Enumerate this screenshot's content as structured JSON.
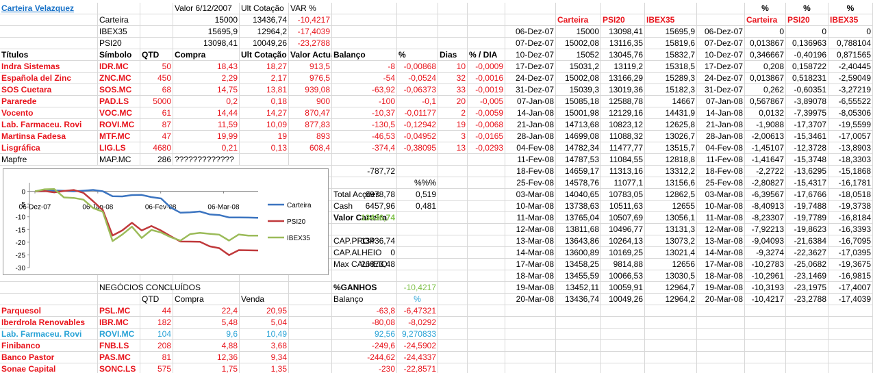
{
  "header": {
    "title": "Carteira Velazquez",
    "col_headers": [
      "Valor 6/12/2007",
      "Ult Cotação",
      "VAR %"
    ],
    "index_rows": [
      {
        "name": "Carteira",
        "base": "15000",
        "current": "13436,74",
        "var": "-10,4217"
      },
      {
        "name": "IBEX35",
        "base": "15695,9",
        "current": "12964,2",
        "var": "-17,4039"
      },
      {
        "name": "PSI20",
        "base": "13098,41",
        "current": "10049,26",
        "var": "-23,2788"
      }
    ]
  },
  "holdings": {
    "headers": [
      "Títulos",
      "Símbolo",
      "QTD",
      "Compra",
      "Ult Cotação",
      "Valor Actual",
      "Balanço",
      "%",
      "Dias",
      "% / DIA"
    ],
    "rows": [
      [
        "Indra Sistemas",
        "IDR.MC",
        "50",
        "18,43",
        "18,27",
        "913,5",
        "-8",
        "-0,00868",
        "10",
        "-0,0009"
      ],
      [
        "Española del Zinc",
        "ZNC.MC",
        "450",
        "2,29",
        "2,17",
        "976,5",
        "-54",
        "-0,0524",
        "32",
        "-0,0016"
      ],
      [
        "SOS Cuetara",
        "SOS.MC",
        "68",
        "14,75",
        "13,81",
        "939,08",
        "-63,92",
        "-0,06373",
        "33",
        "-0,0019"
      ],
      [
        "Pararede",
        "PAD.LS",
        "5000",
        "0,2",
        "0,18",
        "900",
        "-100",
        "-0,1",
        "20",
        "-0,005"
      ],
      [
        "Vocento",
        "VOC.MC",
        "61",
        "14,44",
        "14,27",
        "870,47",
        "-10,37",
        "-0,01177",
        "2",
        "-0,0059"
      ],
      [
        "Lab. Farmaceu. Rovi",
        "ROVI.MC",
        "87",
        "11,59",
        "10,09",
        "877,83",
        "-130,5",
        "-0,12942",
        "19",
        "-0,0068"
      ],
      [
        "Martinsa Fadesa",
        "MTF.MC",
        "47",
        "19,99",
        "19",
        "893",
        "-46,53",
        "-0,04952",
        "3",
        "-0,0165"
      ],
      [
        "Lisgráfica",
        "LIG.LS",
        "4680",
        "0,21",
        "0,13",
        "608,4",
        "-374,4",
        "-0,38095",
        "13",
        "-0,0293"
      ]
    ],
    "mapfre": {
      "name": "Mapfre",
      "symbol": "MAP.MC",
      "qtd": "286",
      "compra": "?????????????"
    },
    "balance_total": "-787,72"
  },
  "summary": {
    "pct_header": "%%%",
    "rows": [
      {
        "label": "Total Acções",
        "value": "6978,78",
        "pct": "0,519"
      },
      {
        "label": "Cash",
        "value": "6457,96",
        "pct": "0,481"
      }
    ],
    "valor_label": "Valor Carteira",
    "valor_value": "13436,74",
    "cap_rows": [
      {
        "label": "CAP.PROP",
        "value": "13436,74"
      },
      {
        "label": "CAP.ALHEIO",
        "value": "0"
      },
      {
        "label": "Max CALHEIO",
        "value": "26873,48"
      }
    ],
    "ganhos_label": "%GANHOS",
    "ganhos_value": "-10,4217"
  },
  "closed": {
    "title": "NEGÓCIOS CONCLUÍDOS",
    "headers": [
      "QTD",
      "Compra",
      "Venda",
      "Balanço",
      "%"
    ],
    "rows": [
      [
        "Parquesol",
        "PSL.MC",
        "44",
        "22,4",
        "20,95",
        "-63,8",
        "-6,47321"
      ],
      [
        "Iberdrola Renovables",
        "IBR.MC",
        "182",
        "5,48",
        "5,04",
        "-80,08",
        "-8,0292"
      ],
      [
        "Lab. Farmaceu. Rovi",
        "ROVI.MC",
        "104",
        "9,6",
        "10,49",
        "92,56",
        "9,270833"
      ],
      [
        "Finibanco",
        "FNB.LS",
        "208",
        "4,88",
        "3,68",
        "-249,6",
        "-24,5902"
      ],
      [
        "Banco Pastor",
        "PAS.MC",
        "81",
        "12,36",
        "9,34",
        "-244,62",
        "-24,4337"
      ],
      [
        "Sonae Capital",
        "SONC.LS",
        "575",
        "1,75",
        "1,35",
        "-230",
        "-22,8571"
      ]
    ]
  },
  "history": {
    "headers": [
      "Carteira",
      "PSI20",
      "IBEX35"
    ],
    "rows": [
      [
        "06-Dez-07",
        "15000",
        "13098,41",
        "15695,9"
      ],
      [
        "07-Dez-07",
        "15002,08",
        "13116,35",
        "15819,6"
      ],
      [
        "10-Dez-07",
        "15052",
        "13045,76",
        "15832,7"
      ],
      [
        "17-Dez-07",
        "15031,2",
        "13119,2",
        "15318,5"
      ],
      [
        "24-Dez-07",
        "15002,08",
        "13166,29",
        "15289,3"
      ],
      [
        "31-Dez-07",
        "15039,3",
        "13019,36",
        "15182,3"
      ],
      [
        "07-Jan-08",
        "15085,18",
        "12588,78",
        "14667"
      ],
      [
        "14-Jan-08",
        "15001,98",
        "12129,16",
        "14431,9"
      ],
      [
        "21-Jan-08",
        "14713,68",
        "10823,12",
        "12625,8"
      ],
      [
        "28-Jan-08",
        "14699,08",
        "11088,32",
        "13026,7"
      ],
      [
        "04-Fev-08",
        "14782,34",
        "11477,77",
        "13515,7"
      ],
      [
        "11-Fev-08",
        "14787,53",
        "11084,55",
        "12818,8"
      ],
      [
        "18-Fev-08",
        "14659,17",
        "11313,16",
        "13312,2"
      ],
      [
        "25-Fev-08",
        "14578,76",
        "11077,1",
        "13156,6"
      ],
      [
        "03-Mar-08",
        "14040,65",
        "10783,05",
        "12862,5"
      ],
      [
        "10-Mar-08",
        "13738,63",
        "10511,63",
        "12655"
      ],
      [
        "11-Mar-08",
        "13765,04",
        "10507,69",
        "13056,1"
      ],
      [
        "12-Mar-08",
        "13811,68",
        "10496,77",
        "13131,3"
      ],
      [
        "13-Mar-08",
        "13643,86",
        "10264,13",
        "13073,2"
      ],
      [
        "14-Mar-08",
        "13600,89",
        "10169,25",
        "13021,4"
      ],
      [
        "17-Mar-08",
        "13458,25",
        "9814,88",
        "12656"
      ],
      [
        "18-Mar-08",
        "13455,59",
        "10066,53",
        "13030,5"
      ],
      [
        "19-Mar-08",
        "13452,11",
        "10059,91",
        "12964,7"
      ],
      [
        "20-Mar-08",
        "13436,74",
        "10049,26",
        "12964,2"
      ]
    ]
  },
  "pct_history": {
    "pct_row": [
      "%",
      "%",
      "%"
    ],
    "headers": [
      "Carteira",
      "PSI20",
      "IBEX35"
    ],
    "rows": [
      [
        "06-Dez-07",
        "0",
        "0",
        "0"
      ],
      [
        "07-Dez-07",
        "0,013867",
        "0,136963",
        "0,788104"
      ],
      [
        "10-Dez-07",
        "0,346667",
        "-0,40196",
        "0,871565"
      ],
      [
        "17-Dez-07",
        "0,208",
        "0,158722",
        "-2,40445"
      ],
      [
        "24-Dez-07",
        "0,013867",
        "0,518231",
        "-2,59049"
      ],
      [
        "31-Dez-07",
        "0,262",
        "-0,60351",
        "-3,27219"
      ],
      [
        "07-Jan-08",
        "0,567867",
        "-3,89078",
        "-6,55522"
      ],
      [
        "14-Jan-08",
        "0,0132",
        "-7,39975",
        "-8,05306"
      ],
      [
        "21-Jan-08",
        "-1,9088",
        "-17,3707",
        "-19,5599"
      ],
      [
        "28-Jan-08",
        "-2,00613",
        "-15,3461",
        "-17,0057"
      ],
      [
        "04-Fev-08",
        "-1,45107",
        "-12,3728",
        "-13,8903"
      ],
      [
        "11-Fev-08",
        "-1,41647",
        "-15,3748",
        "-18,3303"
      ],
      [
        "18-Fev-08",
        "-2,2722",
        "-13,6295",
        "-15,1868"
      ],
      [
        "25-Fev-08",
        "-2,80827",
        "-15,4317",
        "-16,1781"
      ],
      [
        "03-Mar-08",
        "-6,39567",
        "-17,6766",
        "-18,0518"
      ],
      [
        "10-Mar-08",
        "-8,40913",
        "-19,7488",
        "-19,3738"
      ],
      [
        "11-Mar-08",
        "-8,23307",
        "-19,7789",
        "-16,8184"
      ],
      [
        "12-Mar-08",
        "-7,92213",
        "-19,8623",
        "-16,3393"
      ],
      [
        "13-Mar-08",
        "-9,04093",
        "-21,6384",
        "-16,7095"
      ],
      [
        "14-Mar-08",
        "-9,3274",
        "-22,3627",
        "-17,0395"
      ],
      [
        "17-Mar-08",
        "-10,2783",
        "-25,0682",
        "-19,3675"
      ],
      [
        "18-Mar-08",
        "-10,2961",
        "-23,1469",
        "-16,9815"
      ],
      [
        "19-Mar-08",
        "-10,3193",
        "-23,1975",
        "-17,4007"
      ],
      [
        "20-Mar-08",
        "-10,4217",
        "-23,2788",
        "-17,4039"
      ]
    ]
  },
  "colors": {
    "red": "#e8141c",
    "green": "#7fc14a",
    "cyan": "#2aa3d6",
    "link": "#1a73c8",
    "carteira_line": "#3b74c0",
    "psi20_line": "#c0393b",
    "ibex_line": "#9bbb59"
  },
  "chart_data": {
    "type": "line",
    "x": [
      "06-Dez-07",
      "07-Dez-07",
      "10-Dez-07",
      "17-Dez-07",
      "24-Dez-07",
      "31-Dez-07",
      "07-Jan-08",
      "14-Jan-08",
      "21-Jan-08",
      "28-Jan-08",
      "04-Fev-08",
      "11-Fev-08",
      "18-Fev-08",
      "25-Fev-08",
      "03-Mar-08",
      "10-Mar-08",
      "11-Mar-08",
      "12-Mar-08",
      "13-Mar-08",
      "14-Mar-08",
      "17-Mar-08",
      "18-Mar-08",
      "19-Mar-08",
      "20-Mar-08"
    ],
    "series": [
      {
        "name": "Carteira",
        "values": [
          0,
          0.013867,
          0.346667,
          0.208,
          0.013867,
          0.262,
          0.567867,
          0.0132,
          -1.9088,
          -2.00613,
          -1.45107,
          -1.41647,
          -2.2722,
          -2.80827,
          -6.39567,
          -8.40913,
          -8.23307,
          -7.92213,
          -9.04093,
          -9.3274,
          -10.2783,
          -10.2961,
          -10.3193,
          -10.4217
        ]
      },
      {
        "name": "PSI20",
        "values": [
          0,
          0.136963,
          -0.40196,
          0.158722,
          0.518231,
          -0.60351,
          -3.89078,
          -7.39975,
          -17.3707,
          -15.3461,
          -12.3728,
          -15.3748,
          -13.6295,
          -15.4317,
          -17.6766,
          -19.7488,
          -19.7789,
          -19.8623,
          -21.6384,
          -22.3627,
          -25.0682,
          -23.1469,
          -23.1975,
          -23.2788
        ]
      },
      {
        "name": "IBEX35",
        "values": [
          0,
          0.788104,
          0.871565,
          -2.40445,
          -2.59049,
          -3.27219,
          -6.55522,
          -8.05306,
          -19.5599,
          -17.0057,
          -13.8903,
          -18.3303,
          -15.1868,
          -16.1781,
          -18.0518,
          -19.3738,
          -16.8184,
          -16.3393,
          -16.7095,
          -17.0395,
          -19.3675,
          -16.9815,
          -17.4007,
          -17.4039
        ]
      }
    ],
    "y_ticks": [
      "0",
      "-5",
      "-10",
      "-15",
      "-20",
      "-25",
      "-30"
    ],
    "x_ticks": [
      "06-Dez-07",
      "06-Jan-08",
      "06-Fev-08",
      "06-Mar-08"
    ],
    "ylim": [
      -30,
      5
    ],
    "legend": "right"
  }
}
